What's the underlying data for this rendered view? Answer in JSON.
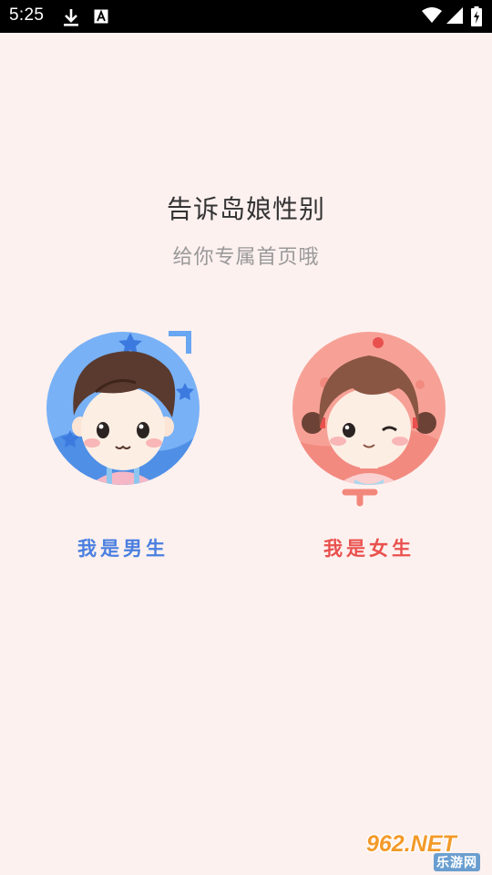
{
  "status_bar": {
    "time": "5:25",
    "icons": [
      "download-icon",
      "text-a-icon",
      "wifi-icon",
      "signal-icon",
      "battery-charging-icon"
    ]
  },
  "content": {
    "title": "告诉岛娘性别",
    "subtitle": "给你专属首页哦"
  },
  "options": {
    "male_label": "我是男生",
    "female_label": "我是女生",
    "male_color": "#4a7fe0",
    "female_color": "#e9514e"
  },
  "watermark": {
    "main": "962.NET",
    "sub": "乐游网"
  },
  "colors": {
    "background": "#fdf1ef",
    "male_accent": "#6aa7f2",
    "female_accent": "#f2877c"
  }
}
